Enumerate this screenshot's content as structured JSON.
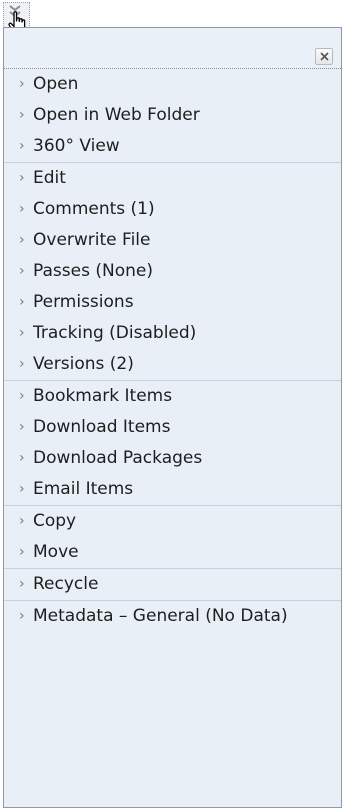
{
  "menu": {
    "groups": [
      {
        "items": [
          {
            "label": "Open"
          },
          {
            "label": "Open in Web Folder"
          },
          {
            "label": "360° View"
          }
        ]
      },
      {
        "items": [
          {
            "label": "Edit"
          },
          {
            "label": "Comments (1)"
          },
          {
            "label": "Overwrite File"
          },
          {
            "label": "Passes (None)"
          },
          {
            "label": "Permissions"
          },
          {
            "label": "Tracking (Disabled)"
          },
          {
            "label": "Versions (2)"
          }
        ]
      },
      {
        "items": [
          {
            "label": "Bookmark Items"
          },
          {
            "label": "Download Items"
          },
          {
            "label": "Download Packages"
          },
          {
            "label": "Email Items"
          }
        ]
      },
      {
        "items": [
          {
            "label": "Copy"
          },
          {
            "label": "Move"
          }
        ]
      },
      {
        "items": [
          {
            "label": "Recycle"
          }
        ]
      },
      {
        "items": [
          {
            "label": "Metadata – General (No Data)"
          }
        ]
      }
    ],
    "item_arrow": "›",
    "close_icon": "x-close-icon",
    "trigger_icon": "double-chevron-down-icon",
    "cursor_icon": "hand-pointer-icon"
  },
  "colors": {
    "menu_bg": "#e9eff7",
    "menu_border": "#8e98a8",
    "separator": "#c7d0de",
    "text": "#1e1e1e"
  }
}
